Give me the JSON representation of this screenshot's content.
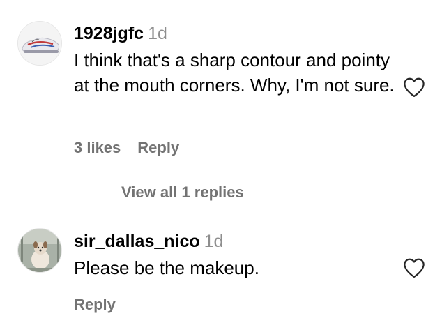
{
  "comments": [
    {
      "username": "1928jgfc",
      "time": "1d",
      "text": "I think that's a sharp contour and pointy at the mouth corners. Why, I'm not sure.",
      "likes": "3 likes",
      "reply_label": "Reply",
      "avatar_icon": "sneaker-icon",
      "view_replies": "View all 1 replies"
    },
    {
      "username": "sir_dallas_nico",
      "time": "1d",
      "text": "Please be the makeup.",
      "reply_label": "Reply",
      "avatar_icon": "dog-photo-icon"
    }
  ],
  "colors": {
    "text": "#000000",
    "muted": "#8e8e8e",
    "action": "#737373",
    "divider": "#c7c7c7"
  }
}
